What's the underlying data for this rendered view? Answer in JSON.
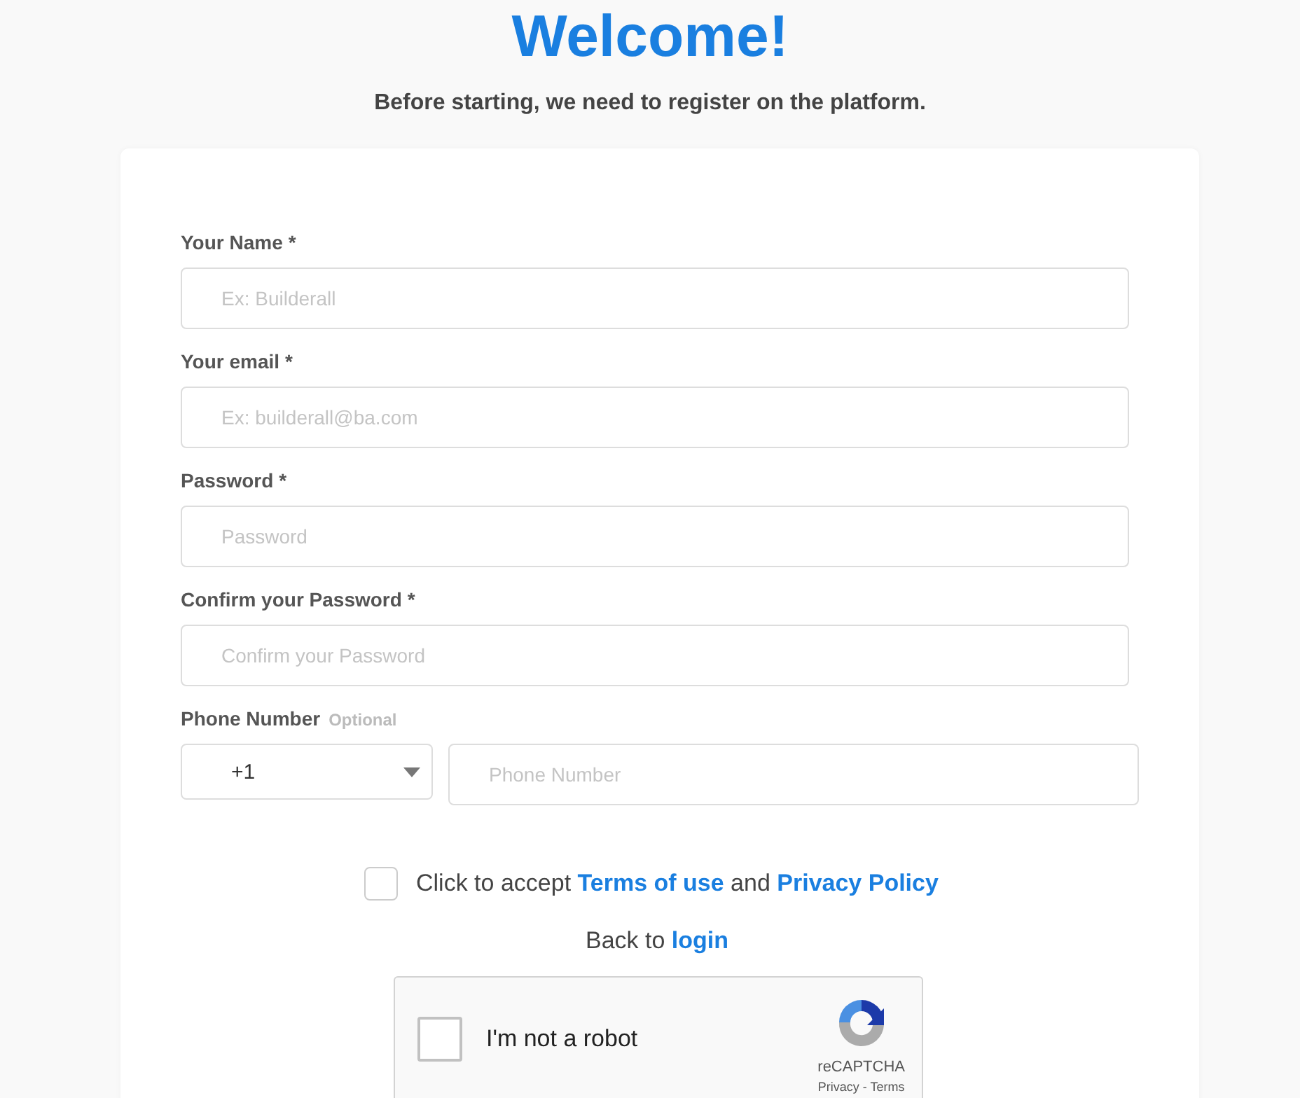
{
  "header": {
    "title": "Welcome!",
    "subtitle": "Before starting, we need to register on the platform."
  },
  "fields": [
    {
      "label": "Your Name",
      "required_mark": "*",
      "placeholder": "Ex: Builderall"
    },
    {
      "label": "Your email",
      "required_mark": "*",
      "placeholder": "Ex: builderall@ba.com"
    },
    {
      "label": "Password",
      "required_mark": "*",
      "placeholder": "Password"
    },
    {
      "label": "Confirm your Password",
      "required_mark": "*",
      "placeholder": "Confirm your Password"
    }
  ],
  "phone": {
    "label": "Phone Number",
    "hint": "Optional",
    "country_code": "+1",
    "placeholder": "Phone Number"
  },
  "terms": {
    "checked": false,
    "text": "Click to accept",
    "link_1": "Terms of use",
    "joiner": "and",
    "link_2": "Privacy Policy"
  },
  "back": {
    "text": "Back to",
    "link": "login"
  },
  "captcha": {
    "checked": false,
    "label": "I'm not a robot",
    "brand": "reCAPTCHA",
    "footer": "Privacy - Terms"
  }
}
